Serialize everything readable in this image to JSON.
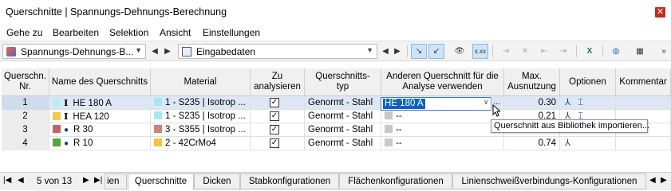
{
  "window": {
    "title": "Querschnitte | Spannungs-Dehnungs-Berechnung",
    "close": "✕"
  },
  "menu": [
    "Gehe zu",
    "Bearbeiten",
    "Selektion",
    "Ansicht",
    "Einstellungen"
  ],
  "toolbar": {
    "analysis_combo": "Spannungs-Dehnungs-B...",
    "data_combo": "Eingabedaten"
  },
  "table": {
    "headers": {
      "nr": "Querschn.\nNr.",
      "name": "Name des Querschnitts",
      "material": "Material",
      "analyze": "Zu\nanalysieren",
      "type": "Querschnitts-\ntyp",
      "other": "Anderen Querschnitt für die\nAnalyse verwenden",
      "util": "Max.\nAusnutzung",
      "options": "Optionen",
      "comment": "Kommentar"
    },
    "rows": [
      {
        "nr": "1",
        "name": "HE 180 A",
        "name_color": "#b9ecf5",
        "name_symbol": "I",
        "material": "1 - S235 | Isotrop ...",
        "material_color": "#a6e8f2",
        "analyze": true,
        "type": "Genormt - Stahl",
        "other": "HE 180 A",
        "util": "0.30"
      },
      {
        "nr": "2",
        "name": "HEA 120",
        "name_color": "#f2c94c",
        "name_symbol": "I",
        "material": "1 - S235 | Isotrop ...",
        "material_color": "#a6e8f2",
        "analyze": true,
        "type": "Genormt - Stahl",
        "other": "--",
        "util": "0.21"
      },
      {
        "nr": "3",
        "name": "R 30",
        "name_color": "#c0666a",
        "name_symbol": "●",
        "material": "3 - S355 | Isotrop ...",
        "material_color": "#c9847a",
        "analyze": true,
        "type": "Genormt - Stahl",
        "other": "--",
        "util": ""
      },
      {
        "nr": "4",
        "name": "R 10",
        "name_color": "#55a637",
        "name_symbol": "●",
        "material": "2 - 42CrMo4",
        "material_color": "#f5c542",
        "analyze": true,
        "type": "Genormt - Stahl",
        "other": "--",
        "util": "0.74"
      }
    ]
  },
  "tooltip": "Querschnitt aus Bibliothek importieren...",
  "tabs": {
    "page_info": "5 von 13",
    "items": [
      "ien",
      "Querschnitte",
      "Dicken",
      "Stabkonfigurationen",
      "Flächenkonfigurationen",
      "Linienschweißverbindungs-Konfigurationen"
    ],
    "active": "Querschnitte"
  },
  "colors": {
    "selection": "#dde8f6",
    "accent": "#0a62c4"
  }
}
